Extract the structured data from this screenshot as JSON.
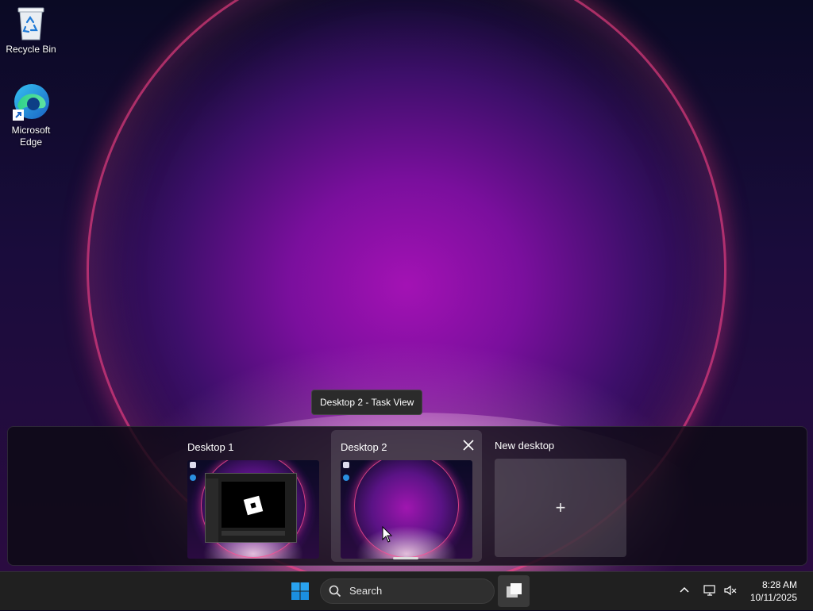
{
  "desktop": {
    "icons": [
      {
        "label": "Recycle Bin",
        "icon": "recycle-bin-icon"
      },
      {
        "label": "Microsoft Edge",
        "icon": "edge-icon"
      }
    ]
  },
  "tooltip": {
    "text": "Desktop 2 - Task View"
  },
  "task_view": {
    "desktops": [
      {
        "title": "Desktop 1",
        "active": false
      },
      {
        "title": "Desktop 2",
        "active": true
      }
    ],
    "new_desktop": {
      "title": "New desktop",
      "icon": "plus-icon"
    },
    "close_icon": "close-icon"
  },
  "taskbar": {
    "start_icon": "windows-start-icon",
    "search": {
      "label": "Search",
      "icon": "search-icon"
    },
    "task_view_icon": "task-view-icon",
    "tray": {
      "chevron_icon": "chevron-up-icon",
      "network_icon": "network-icon",
      "volume_icon": "volume-muted-icon",
      "time": "8:28 AM",
      "date": "10/11/2025"
    }
  },
  "colors": {
    "accent": "#0078d4",
    "taskbar_bg": "#202020"
  }
}
